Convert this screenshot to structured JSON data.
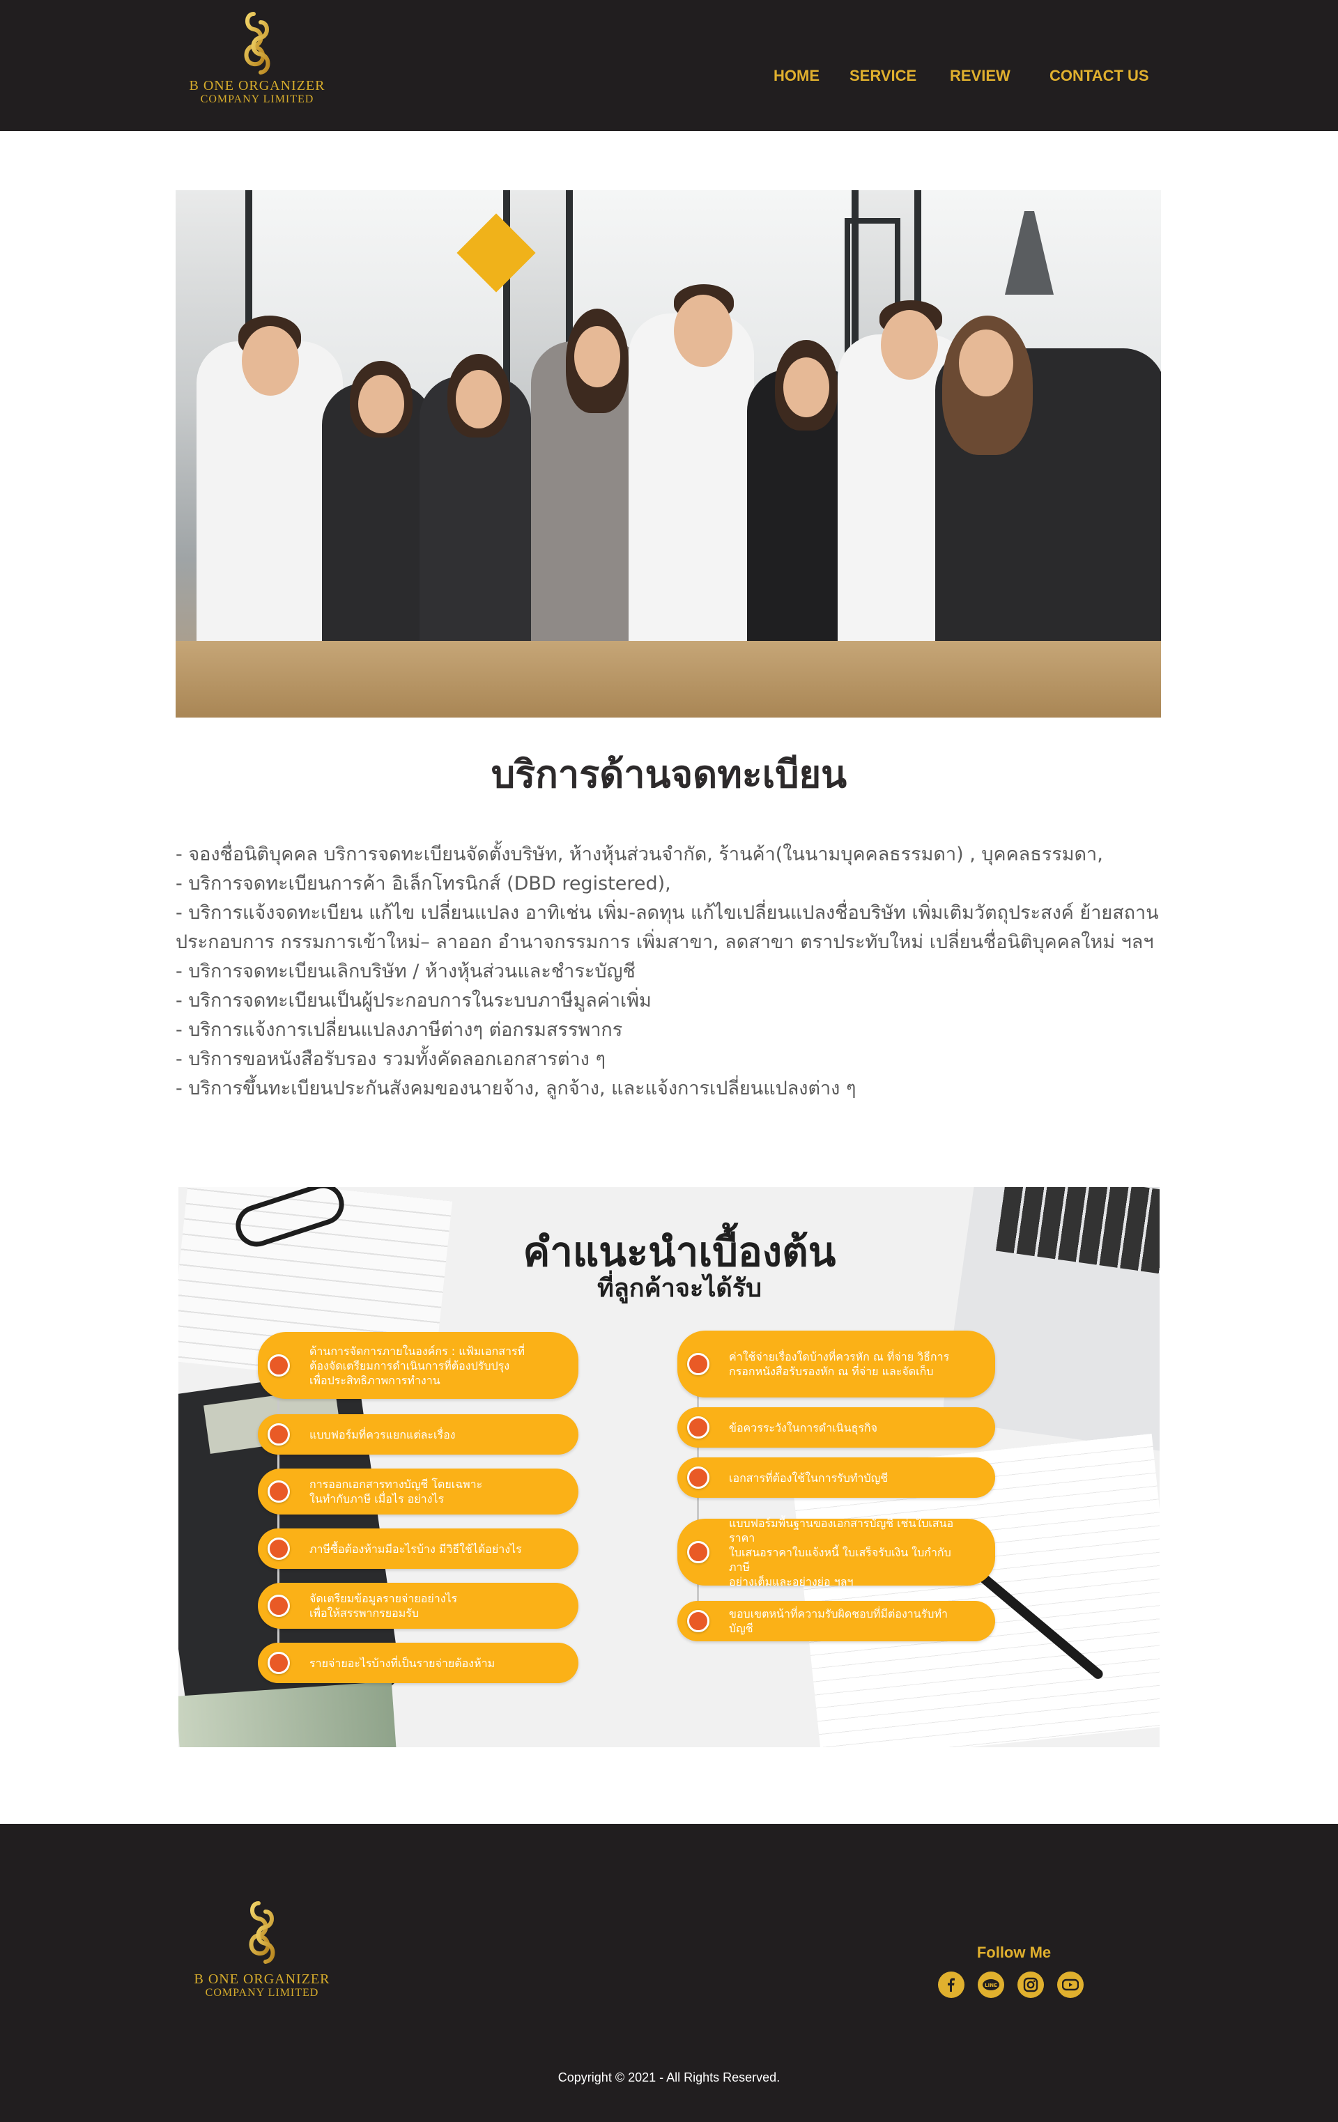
{
  "header": {
    "logo": {
      "line1": "B ONE ORGANIZER",
      "line2": "COMPANY LIMITED"
    },
    "nav": [
      {
        "label": "HOME"
      },
      {
        "label": "SERVICE"
      },
      {
        "label": "REVIEW"
      },
      {
        "label": "CONTACT US"
      }
    ]
  },
  "main": {
    "title": "บริการด้านจดทะเบียน",
    "services": [
      "- จองชื่อนิติบุคคล บริการจดทะเบียนจัดตั้งบริษัท, ห้างหุ้นส่วนจำกัด, ร้านค้า(ในนามบุคคลธรรมดา) , บุคคลธรรมดา,",
      "- บริการจดทะเบียนการค้า อิเล็กโทรนิกส์ (DBD registered),",
      "- บริการแจ้งจดทะเบียน แก้ไข เปลี่ยนแปลง อาทิเช่น เพิ่ม-ลดทุน แก้ไขเปลี่ยนแปลงชื่อบริษัท เพิ่มเติมวัตถุประสงค์  ย้ายสถาน",
      "ประกอบการ  กรรมการเข้าใหม่– ลาออก  อำนาจกรรมการ  เพิ่มสาขา, ลดสาขา ตราประทับใหม่ เปลี่ยนชื่อนิติบุคคลใหม่ ฯลฯ",
      "- บริการจดทะเบียนเลิกบริษัท / ห้างหุ้นส่วนและชำระบัญชี",
      "- บริการจดทะเบียนเป็นผู้ประกอบการในระบบภาษีมูลค่าเพิ่ม",
      "- บริการแจ้งการเปลี่ยนแปลงภาษีต่างๆ ต่อกรมสรรพากร",
      "- บริการขอหนังสือรับรอง รวมทั้งคัดลอกเอกสารต่าง ๆ",
      "- บริการขึ้นทะเบียนประกันสังคมของนายจ้าง, ลูกจ้าง, และแจ้งการเปลี่ยนแปลงต่าง ๆ"
    ]
  },
  "infographic": {
    "heading1": "คำแนะนำเบื้องต้น",
    "heading2": "ที่ลูกค้าจะได้รับ",
    "left": [
      [
        "ด้านการจัดการภายในองค์กร : แฟ้มเอกสารที่",
        "ต้องจัดเตรียมการดำเนินการที่ต้องปรับปรุง",
        "เพื่อประสิทธิภาพการทำงาน"
      ],
      [
        "แบบฟอร์มที่ควรแยกแต่ละเรื่อง"
      ],
      [
        "การออกเอกสารทางบัญชี โดยเฉพาะ",
        "ในทำกับภาษี เมื่อไร อย่างไร"
      ],
      [
        "ภาษีซื้อต้องห้ามมีอะไรบ้าง มีวิธีใช้ได้อย่างไร"
      ],
      [
        "จัดเตรียมข้อมูลรายจ่ายอย่างไร",
        "เพื่อให้สรรพากรยอมรับ"
      ],
      [
        "รายจ่ายอะไรบ้างที่เป็นรายจ่ายต้องห้าม"
      ]
    ],
    "right": [
      [
        "ค่าใช้จ่ายเรื่องใดบ้างที่ควรหัก ณ ที่จ่าย วิธีการ",
        "กรอกหนังสือรับรองหัก ณ ที่จ่าย และจัดเก็บ"
      ],
      [
        "ข้อควรระวังในการดำเนินธุรกิจ"
      ],
      [
        "เอกสารที่ต้องใช้ในการรับทำบัญชี"
      ],
      [
        "แบบฟอร์มพื้นฐานของเอกสารบัญชี เช่นใบเสนอราคา",
        "ใบเสนอราคาใบแจ้งหนี้ ใบเสร็จรับเงิน ใบกำกับภาษี",
        "อย่างเต็มและอย่างย่อ ฯลฯ"
      ],
      [
        "ขอบเขตหน้าที่ความรับผิดชอบที่มีต่องานรับทำบัญชี"
      ]
    ]
  },
  "footer": {
    "logo": {
      "line1": "B ONE ORGANIZER",
      "line2": "COMPANY LIMITED"
    },
    "follow_label": "Follow Me",
    "socials": [
      "facebook-icon",
      "line-icon",
      "instagram-icon",
      "youtube-icon"
    ],
    "copyright": "Copyright © 2021 - All Rights Reserved."
  },
  "colors": {
    "dark": "#211e1f",
    "gold": "#e0b02e",
    "pill": "#fbb117",
    "dot": "#e95a26"
  }
}
